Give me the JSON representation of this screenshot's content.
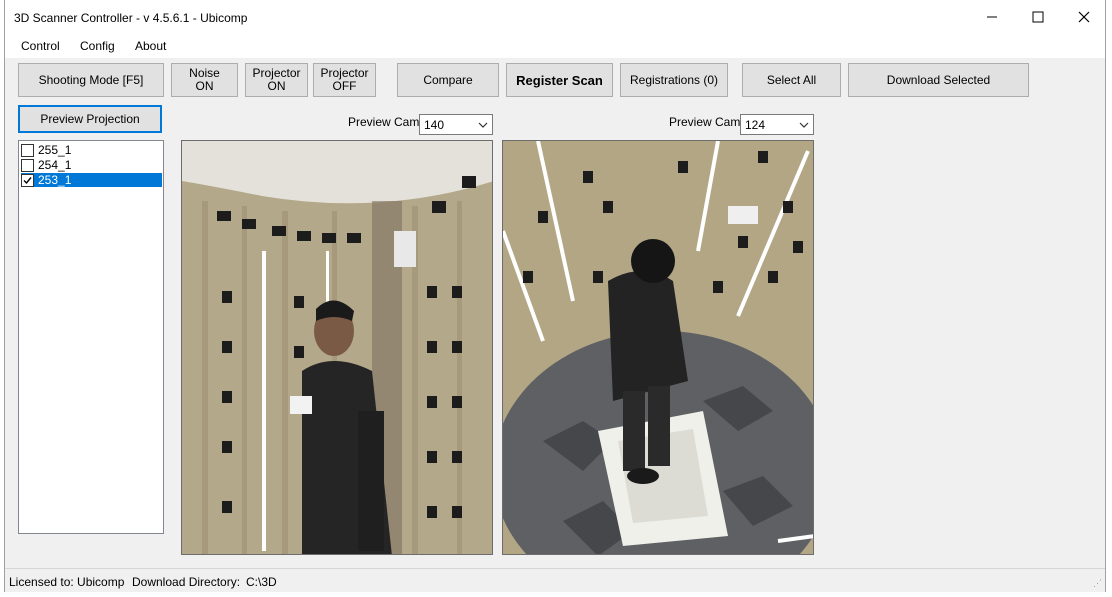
{
  "window": {
    "title": "3D Scanner Controller - v 4.5.6.1 - Ubicomp",
    "minimize_glyph": "—",
    "maximize_glyph": "☐",
    "close_glyph": "✕"
  },
  "menu": [
    "Control",
    "Config",
    "About"
  ],
  "toolbar": {
    "shooting_mode": "Shooting Mode [F5]",
    "noise_line1": "Noise",
    "noise_line2": "ON",
    "projector_on_line1": "Projector",
    "projector_on_line2": "ON",
    "projector_off_line1": "Projector",
    "projector_off_line2": "OFF",
    "compare": "Compare",
    "register_scan": "Register Scan",
    "registrations": "Registrations  (0)",
    "select_all": "Select All",
    "download_selected": "Download Selected"
  },
  "preview_projection": "Preview Projection",
  "scan_list": [
    {
      "label": "255_1",
      "checked": false,
      "selected": false
    },
    {
      "label": "254_1",
      "checked": false,
      "selected": false
    },
    {
      "label": "253_1",
      "checked": true,
      "selected": true
    }
  ],
  "previews": [
    {
      "label": "Preview Cam",
      "cam": "140"
    },
    {
      "label": "Preview Cam",
      "cam": "124"
    }
  ],
  "status": {
    "licensed": "Licensed to: Ubicomp",
    "download_dir_label": "Download Directory:",
    "download_dir": "C:\\3D"
  },
  "colors": {
    "accent": "#0078d7",
    "button_bg": "#e1e1e1",
    "window_bg": "#f0f0f0"
  }
}
